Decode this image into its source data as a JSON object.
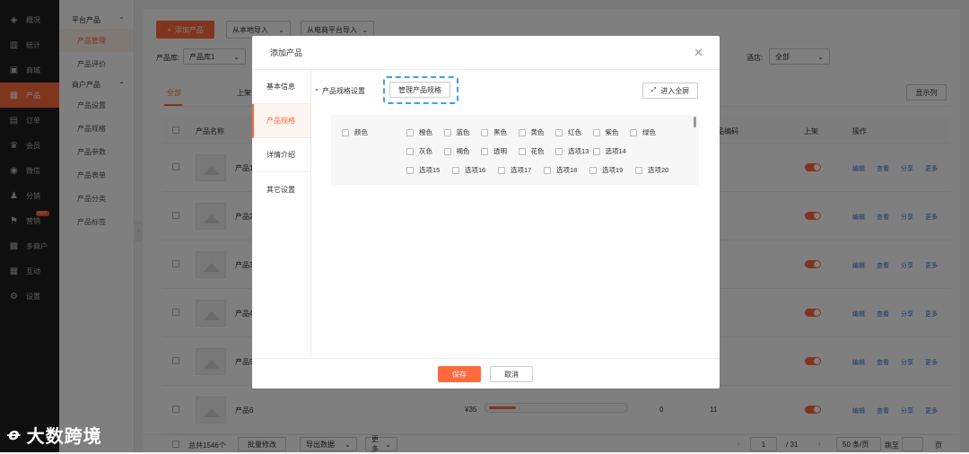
{
  "sidebar": {
    "items": [
      {
        "label": "概况",
        "icon": "layers-icon"
      },
      {
        "label": "统计",
        "icon": "bar-chart-icon"
      },
      {
        "label": "商城",
        "icon": "store-icon"
      },
      {
        "label": "产品",
        "icon": "grid-icon"
      },
      {
        "label": "订单",
        "icon": "clipboard-icon"
      },
      {
        "label": "会员",
        "icon": "crown-icon"
      },
      {
        "label": "微信",
        "icon": "wechat-icon"
      },
      {
        "label": "分销",
        "icon": "users-icon"
      },
      {
        "label": "营销",
        "icon": "flag-icon",
        "badge": "HOT"
      },
      {
        "label": "多商户",
        "icon": "shop-icon"
      },
      {
        "label": "互动",
        "icon": "apps-icon"
      },
      {
        "label": "设置",
        "icon": "gear-icon"
      }
    ]
  },
  "subnav": {
    "group1": "平台产品",
    "group1_items": [
      "产品管理",
      "产品评价"
    ],
    "group2": "商户产品",
    "group2_items": [
      "产品设置",
      "产品规格",
      "产品参数",
      "产品表单",
      "产品分类",
      "产品标签"
    ]
  },
  "toolbar": {
    "add_label": "添加产品",
    "local_import": "从本地导入",
    "ecom_import": "从电商平台导入",
    "library_label": "产品库:",
    "library_value": "产品库1",
    "filter_label": "酒店:",
    "filter_value": "全部",
    "show_columns": "显示列"
  },
  "tabs": [
    "全部",
    "上架"
  ],
  "table": {
    "headers": {
      "name": "产品名称",
      "code": "品编码",
      "status": "上架",
      "ops": "操作"
    },
    "rows": [
      {
        "name": "产品1"
      },
      {
        "name": "产品2"
      },
      {
        "name": "产品3"
      },
      {
        "name": "产品4"
      },
      {
        "name": "产品5"
      },
      {
        "name": "产品6",
        "price": "¥35",
        "qty": "0",
        "code": "11"
      }
    ],
    "ops": [
      "编辑",
      "查看",
      "分享",
      "更多"
    ]
  },
  "footer": {
    "total": "总共1546个",
    "batch": "批量修改",
    "export": "导出数据",
    "more": "更多",
    "page_current": "1",
    "page_total": "/ 31",
    "page_size": "50 条/页",
    "jump": "跳至",
    "page_unit": "页"
  },
  "modal": {
    "title": "添加产品",
    "nav": [
      "基本信息",
      "产品规格",
      "详情介绍",
      "其它设置"
    ],
    "spec_title": "产品规格设置",
    "manage_btn": "管理产品规格",
    "fullscreen_btn": "进入全屏",
    "color_label": "颜色",
    "options_row1": [
      "橙色",
      "蓝色",
      "黑色",
      "黄色",
      "红色",
      "紫色",
      "绿色"
    ],
    "options_row2": [
      "灰色",
      "褐色",
      "透明",
      "花色",
      "选项13",
      "选项14"
    ],
    "options_row3": [
      "选项15",
      "选项16",
      "选项17",
      "选项18",
      "选项19",
      "选项20"
    ],
    "save": "保存",
    "cancel": "取消"
  },
  "watermark": "大数跨境",
  "colors": {
    "accent": "#ff6a3d",
    "highlight": "#3aa3e0"
  }
}
